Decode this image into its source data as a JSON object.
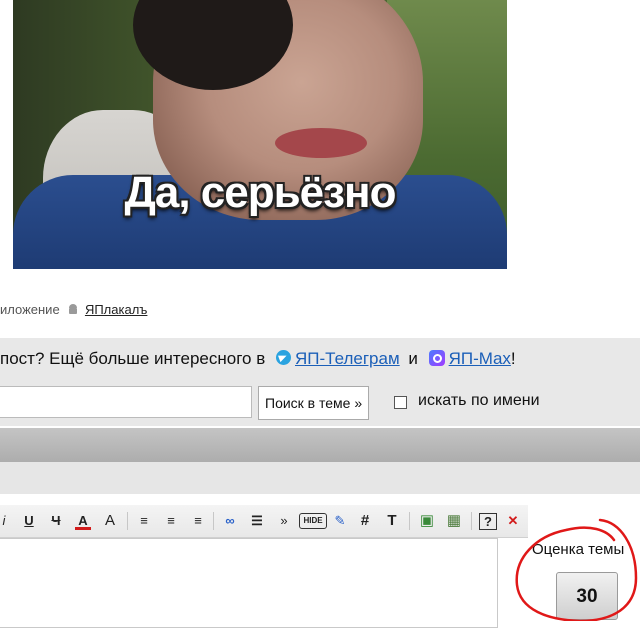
{
  "post": {
    "image_caption": "Да, серьёзно",
    "app_prefix": "иложение",
    "app_link": "ЯПлакалъ"
  },
  "promo": {
    "text_before": "пост? Ещё больше интересного в",
    "telegram_link": "ЯП-Телеграм",
    "conjunction": "и",
    "max_link": "ЯП-Max",
    "text_after": "!"
  },
  "search": {
    "input_value": "",
    "button_label": "Поиск в теме »",
    "by_name_label": "искать по имени"
  },
  "toolbar": {
    "items": [
      "i",
      "U",
      "Ч",
      "A",
      "A",
      "≡",
      "≡",
      "≡",
      "∞",
      "☰",
      "»",
      "HIDE",
      "✎",
      "#",
      "T",
      "▣",
      "▦",
      "?",
      "✕"
    ]
  },
  "rating": {
    "label": "Оценка темы",
    "value": "30"
  },
  "colors": {
    "link": "#1b5fb8",
    "telegram": "#2aa3e0",
    "annotation": "#e01818"
  }
}
